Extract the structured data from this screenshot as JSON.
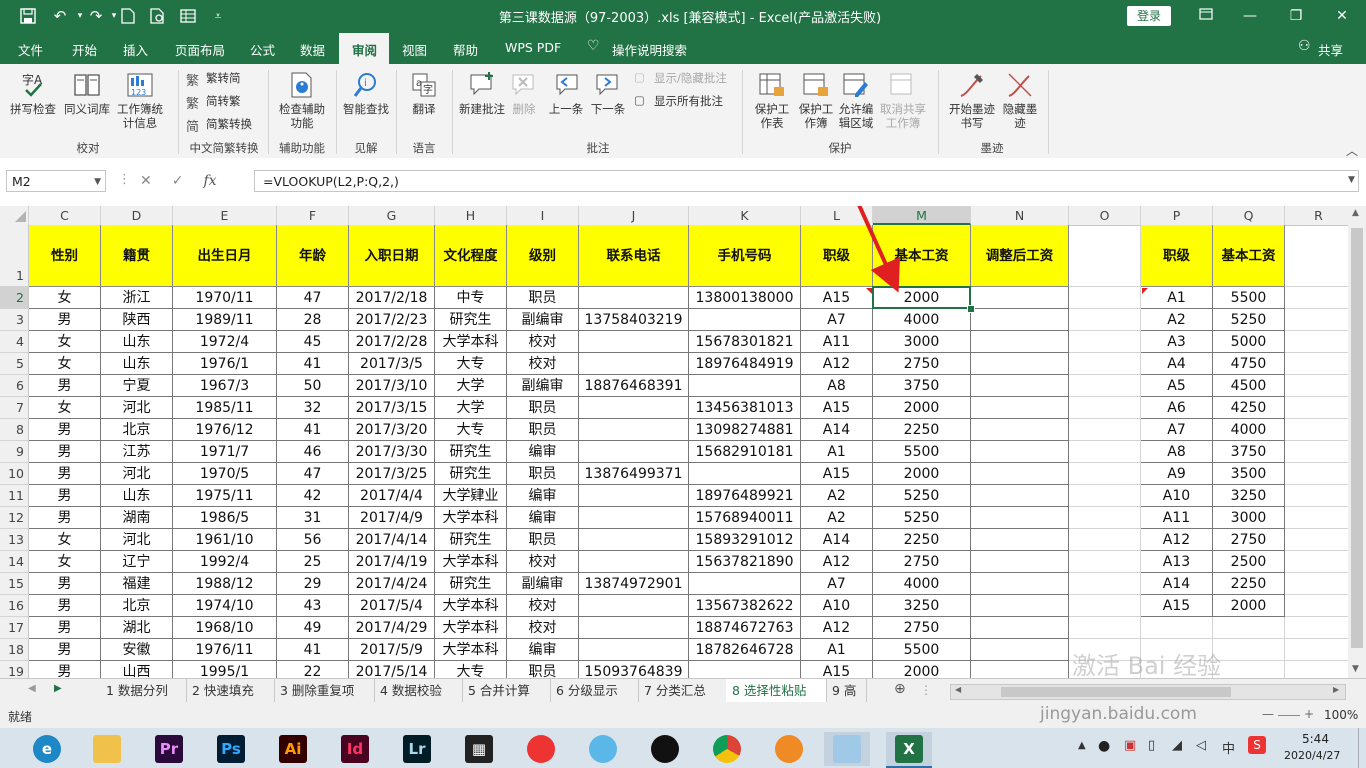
{
  "window": {
    "title": "第三课数据源（97-2003）.xls  [兼容模式]  -  Excel(产品激活失败)",
    "login_label": "登录",
    "share_label": "共享"
  },
  "ribbon_tabs": [
    "文件",
    "开始",
    "插入",
    "页面布局",
    "公式",
    "数据",
    "审阅",
    "视图",
    "帮助",
    "WPS PDF",
    "操作说明搜索"
  ],
  "active_tab": "审阅",
  "ribbon": {
    "proofing": {
      "spell": "拼写检查",
      "thesaurus": "同义词库",
      "stats": "工作簿统计信息",
      "group": "校对"
    },
    "chinese": {
      "t2s": "繁转简",
      "s2t": "简转繁",
      "convert": "简繁转换",
      "group": "中文简繁转换"
    },
    "access": {
      "check": "检查辅助功能",
      "group": "辅助功能"
    },
    "insights": {
      "lookup": "智能查找",
      "group": "见解"
    },
    "language": {
      "translate": "翻译",
      "group": "语言"
    },
    "comments": {
      "new": "新建批注",
      "delete": "删除",
      "prev": "上一条",
      "next": "下一条",
      "showhide": "显示/隐藏批注",
      "showall": "显示所有批注",
      "group": "批注"
    },
    "protect": {
      "sheet": "保护工作表",
      "book": "保护工作簿",
      "ranges": "允许编辑区域",
      "unshare": "取消共享工作簿",
      "group": "保护"
    },
    "ink": {
      "start": "开始墨迹书写",
      "hide": "隐藏墨迹",
      "group": "墨迹"
    }
  },
  "formula_bar": {
    "name_box": "M2",
    "formula": "=VLOOKUP(L2,P:Q,2,)"
  },
  "columns": [
    "C",
    "D",
    "E",
    "F",
    "G",
    "H",
    "I",
    "J",
    "K",
    "L",
    "M",
    "N",
    "O",
    "P",
    "Q",
    "R"
  ],
  "headers": {
    "C": "性别",
    "D": "籍贯",
    "E": "出生日月",
    "F": "年龄",
    "G": "入职日期",
    "H": "文化程度",
    "I": "级别",
    "J": "联系电话",
    "K": "手机号码",
    "L": "职级",
    "M": "基本工资",
    "N": "调整后工资",
    "P": "职级",
    "Q": "基本工资"
  },
  "row_numbers": [
    "1",
    "2",
    "3",
    "4",
    "5",
    "6",
    "7",
    "8",
    "9",
    "10",
    "11",
    "12",
    "13",
    "14",
    "15",
    "16",
    "17",
    "18",
    "19"
  ],
  "rows": [
    [
      "女",
      "浙江",
      "1970/11",
      "47",
      "2017/2/18",
      "中专",
      "职员",
      "",
      "13800138000",
      "A15",
      "2000"
    ],
    [
      "男",
      "陕西",
      "1989/11",
      "28",
      "2017/2/23",
      "研究生",
      "副编审",
      "13758403219",
      "",
      "A7",
      "4000"
    ],
    [
      "女",
      "山东",
      "1972/4",
      "45",
      "2017/2/28",
      "大学本科",
      "校对",
      "",
      "15678301821",
      "A11",
      "3000"
    ],
    [
      "女",
      "山东",
      "1976/1",
      "41",
      "2017/3/5",
      "大专",
      "校对",
      "",
      "18976484919",
      "A12",
      "2750"
    ],
    [
      "男",
      "宁夏",
      "1967/3",
      "50",
      "2017/3/10",
      "大学",
      "副编审",
      "18876468391",
      "",
      "A8",
      "3750"
    ],
    [
      "女",
      "河北",
      "1985/11",
      "32",
      "2017/3/15",
      "大学",
      "职员",
      "",
      "13456381013",
      "A15",
      "2000"
    ],
    [
      "男",
      "北京",
      "1976/12",
      "41",
      "2017/3/20",
      "大专",
      "职员",
      "",
      "13098274881",
      "A14",
      "2250"
    ],
    [
      "男",
      "江苏",
      "1971/7",
      "46",
      "2017/3/30",
      "研究生",
      "编审",
      "",
      "15682910181",
      "A1",
      "5500"
    ],
    [
      "男",
      "河北",
      "1970/5",
      "47",
      "2017/3/25",
      "研究生",
      "职员",
      "13876499371",
      "",
      "A15",
      "2000"
    ],
    [
      "男",
      "山东",
      "1975/11",
      "42",
      "2017/4/4",
      "大学肄业",
      "编审",
      "",
      "18976489921",
      "A2",
      "5250"
    ],
    [
      "男",
      "湖南",
      "1986/5",
      "31",
      "2017/4/9",
      "大学本科",
      "编审",
      "",
      "15768940011",
      "A2",
      "5250"
    ],
    [
      "女",
      "河北",
      "1961/10",
      "56",
      "2017/4/14",
      "研究生",
      "职员",
      "",
      "15893291012",
      "A14",
      "2250"
    ],
    [
      "女",
      "辽宁",
      "1992/4",
      "25",
      "2017/4/19",
      "大学本科",
      "校对",
      "",
      "15637821890",
      "A12",
      "2750"
    ],
    [
      "男",
      "福建",
      "1988/12",
      "29",
      "2017/4/24",
      "研究生",
      "副编审",
      "13874972901",
      "",
      "A7",
      "4000"
    ],
    [
      "男",
      "北京",
      "1974/10",
      "43",
      "2017/5/4",
      "大学本科",
      "校对",
      "",
      "13567382622",
      "A10",
      "3250"
    ],
    [
      "男",
      "湖北",
      "1968/10",
      "49",
      "2017/4/29",
      "大学本科",
      "校对",
      "",
      "18874672763",
      "A12",
      "2750"
    ],
    [
      "男",
      "安徽",
      "1976/11",
      "41",
      "2017/5/9",
      "大学本科",
      "编审",
      "",
      "18782646728",
      "A1",
      "5500"
    ],
    [
      "男",
      "山西",
      "1995/1",
      "22",
      "2017/5/14",
      "大专",
      "职员",
      "15093764839",
      "",
      "A15",
      "2000"
    ]
  ],
  "lookup_table": [
    [
      "A1",
      "5500"
    ],
    [
      "A2",
      "5250"
    ],
    [
      "A3",
      "5000"
    ],
    [
      "A4",
      "4750"
    ],
    [
      "A5",
      "4500"
    ],
    [
      "A6",
      "4250"
    ],
    [
      "A7",
      "4000"
    ],
    [
      "A8",
      "3750"
    ],
    [
      "A9",
      "3500"
    ],
    [
      "A10",
      "3250"
    ],
    [
      "A11",
      "3000"
    ],
    [
      "A12",
      "2750"
    ],
    [
      "A13",
      "2500"
    ],
    [
      "A14",
      "2250"
    ],
    [
      "A15",
      "2000"
    ]
  ],
  "sheet_tabs": [
    "1 数据分列",
    "2 快速填充",
    "3 删除重复项",
    "4 数据校验",
    "5 合并计算",
    "6 分级显示",
    "7 分类汇总",
    "8 选择性粘贴",
    "9 高"
  ],
  "active_sheet": "8 选择性粘贴",
  "status": {
    "ready": "就绪",
    "zoom": "100%"
  },
  "watermark": "jingyan.baidu.com",
  "taskbar": {
    "time": "5:44",
    "date": "2020/4/27",
    "ime": "中"
  },
  "colors": {
    "excel_green": "#217346",
    "header_yellow": "#ffff00",
    "arrow_red": "#e02020"
  }
}
